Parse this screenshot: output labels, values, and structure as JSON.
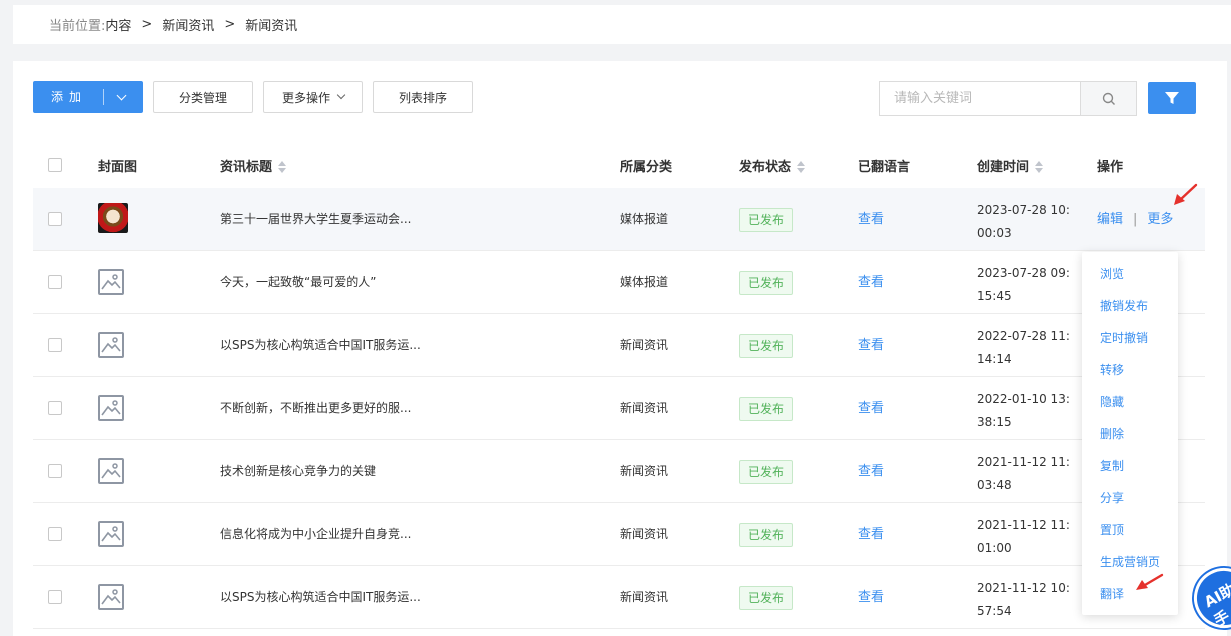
{
  "breadcrumb": {
    "prefix": "当前位置:",
    "items": [
      "内容",
      "新闻资讯",
      "新闻资讯"
    ],
    "separator": ">"
  },
  "toolbar": {
    "add_label": "添加",
    "category_label": "分类管理",
    "more_ops_label": "更多操作",
    "sort_label": "列表排序",
    "search_placeholder": "请输入关键词"
  },
  "table": {
    "columns": {
      "cover": "封面图",
      "title": "资讯标题",
      "category": "所属分类",
      "status": "发布状态",
      "languages": "已翻语言",
      "created": "创建时间",
      "actions": "操作"
    },
    "rows": [
      {
        "title": "第三十一届世界大学生夏季运动会...",
        "category": "媒体报道",
        "status": "已发布",
        "lang": "查看",
        "time": "2023-07-28 10:00:03",
        "cover": "photo"
      },
      {
        "title": "今天，一起致敬“最可爱的人”",
        "category": "媒体报道",
        "status": "已发布",
        "lang": "查看",
        "time": "2023-07-28 09:15:45",
        "cover": "placeholder"
      },
      {
        "title": "以SPS为核心构筑适合中国IT服务运...",
        "category": "新闻资讯",
        "status": "已发布",
        "lang": "查看",
        "time": "2022-07-28 11:14:14",
        "cover": "placeholder"
      },
      {
        "title": "不断创新，不断推出更多更好的服...",
        "category": "新闻资讯",
        "status": "已发布",
        "lang": "查看",
        "time": "2022-01-10 13:38:15",
        "cover": "placeholder"
      },
      {
        "title": "技术创新是核心竞争力的关键",
        "category": "新闻资讯",
        "status": "已发布",
        "lang": "查看",
        "time": "2021-11-12 11:03:48",
        "cover": "placeholder"
      },
      {
        "title": "信息化将成为中小企业提升自身竞...",
        "category": "新闻资讯",
        "status": "已发布",
        "lang": "查看",
        "time": "2021-11-12 11:01:00",
        "cover": "placeholder"
      },
      {
        "title": "以SPS为核心构筑适合中国IT服务运...",
        "category": "新闻资讯",
        "status": "已发布",
        "lang": "查看",
        "time": "2021-11-12 10:57:54",
        "cover": "placeholder"
      }
    ],
    "row_actions": {
      "edit": "编辑",
      "separator": "|",
      "more": "更多"
    }
  },
  "more_menu": {
    "items": [
      "浏览",
      "撤销发布",
      "定时撤销",
      "转移",
      "隐藏",
      "删除",
      "复制",
      "分享",
      "置顶",
      "生成营销页",
      "翻译"
    ]
  },
  "ai_badge": {
    "label": "AI助手"
  },
  "colors": {
    "primary": "#3b8fef",
    "published_bg": "#effaf0",
    "published_text": "#52b25a",
    "arrow": "#e5312c"
  }
}
